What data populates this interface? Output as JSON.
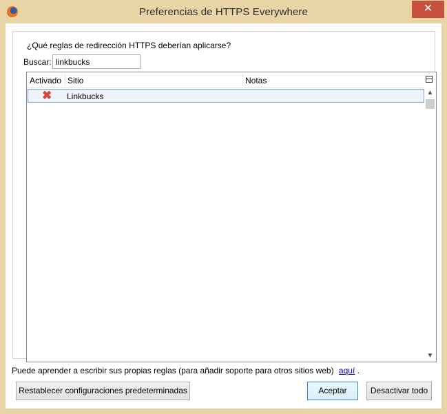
{
  "window": {
    "title": "Preferencias de HTTPS Everywhere",
    "close_glyph": "✕",
    "minimize_glyph": "—",
    "maximize_glyph": "☐",
    "icon": "firefox-icon"
  },
  "dialog": {
    "question": "¿Qué reglas de redirección HTTPS deberían aplicarse?",
    "search_label": "Buscar:",
    "search_value": "linkbucks"
  },
  "table": {
    "columns": [
      "Activado",
      "Sitio",
      "Notas"
    ],
    "rows": [
      {
        "enabled_icon": "red-x-icon",
        "enabled_glyph": "✖",
        "site": "Linkbucks",
        "notes": ""
      }
    ]
  },
  "footer": {
    "learn_text": "Puede aprender a escribir sus propias reglas (para añadir soporte para otros sitios web)",
    "learn_link": "aquí",
    "learn_end": "."
  },
  "buttons": {
    "reset": "Restablecer configuraciones predeterminadas",
    "accept": "Aceptar",
    "disable_all": "Desactivar todo"
  },
  "colors": {
    "frame": "#e9d4a6",
    "close_button": "#c7503f",
    "selection": "#eef3fb",
    "link": "#0000cc"
  }
}
